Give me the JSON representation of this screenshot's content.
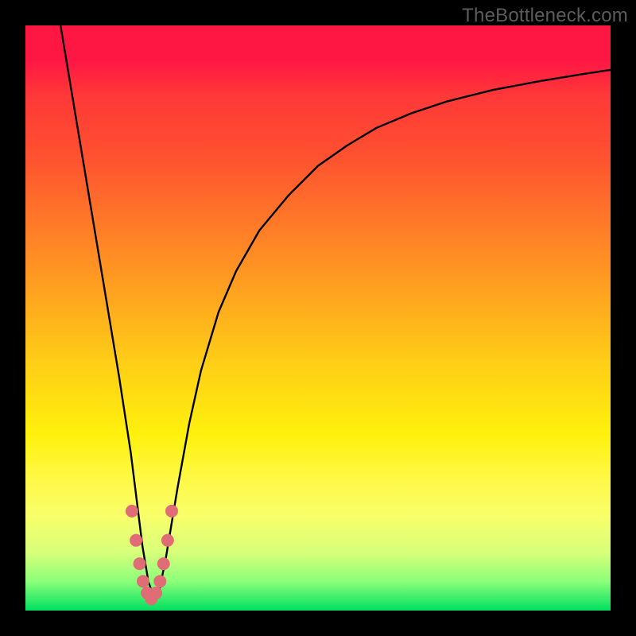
{
  "watermark": "TheBottleneck.com",
  "chart_data": {
    "type": "line",
    "title": "",
    "xlabel": "",
    "ylabel": "",
    "xlim": [
      0,
      100
    ],
    "ylim": [
      0,
      100
    ],
    "series": [
      {
        "name": "bottleneck-curve",
        "x": [
          6,
          8,
          10,
          12,
          14,
          16,
          18,
          19,
          20,
          21,
          22,
          23,
          24,
          26,
          28,
          30,
          33,
          36,
          40,
          45,
          50,
          55,
          60,
          66,
          72,
          80,
          88,
          96,
          100
        ],
        "y": [
          100,
          88,
          76,
          64,
          52,
          40,
          27,
          19,
          11,
          5,
          2,
          4,
          9,
          21,
          32,
          41,
          51,
          58,
          65,
          71,
          76,
          79.5,
          82.5,
          85,
          87,
          89,
          90.5,
          91.8,
          92.4
        ]
      }
    ],
    "markers": {
      "name": "trough-markers",
      "color": "#e06c75",
      "radius_px": 8,
      "points": [
        {
          "x": 18.2,
          "y": 17
        },
        {
          "x": 18.9,
          "y": 12
        },
        {
          "x": 19.5,
          "y": 8
        },
        {
          "x": 20.1,
          "y": 5
        },
        {
          "x": 20.8,
          "y": 3
        },
        {
          "x": 21.5,
          "y": 2
        },
        {
          "x": 22.3,
          "y": 3
        },
        {
          "x": 23.0,
          "y": 5
        },
        {
          "x": 23.6,
          "y": 8
        },
        {
          "x": 24.3,
          "y": 12
        },
        {
          "x": 25.0,
          "y": 17
        }
      ]
    },
    "gradient_stops": [
      {
        "pct": 0,
        "color": "#ff1744"
      },
      {
        "pct": 12,
        "color": "#ff3838"
      },
      {
        "pct": 34,
        "color": "#ff7a28"
      },
      {
        "pct": 58,
        "color": "#ffcf16"
      },
      {
        "pct": 78,
        "color": "#fff94a"
      },
      {
        "pct": 95,
        "color": "#8cff7a"
      },
      {
        "pct": 100,
        "color": "#00e060"
      }
    ]
  }
}
